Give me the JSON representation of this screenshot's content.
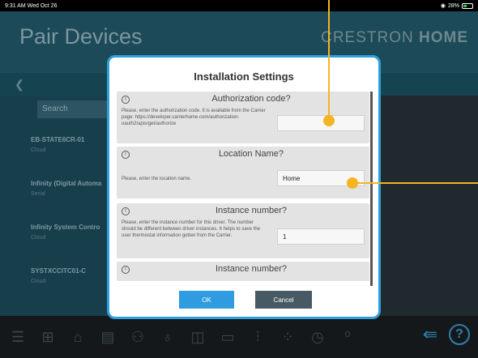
{
  "status_bar": {
    "time_date": "9:31 AM  Wed Oct 26",
    "battery": "28%"
  },
  "app": {
    "title": "Pair Devices",
    "brand_light": "CRESTRON",
    "brand_bold": "HOME"
  },
  "search": {
    "label": "Search"
  },
  "devices": [
    {
      "name": "EB-STATE6CR-01",
      "type": "Cloud"
    },
    {
      "name": "Infinity (Digital Automa",
      "type": "Serial"
    },
    {
      "name": "Infinity System Contro",
      "type": "Cloud"
    },
    {
      "name": "SYSTXCCITC01-C",
      "type": "Cloud"
    }
  ],
  "modal": {
    "title": "Installation Settings",
    "sections": [
      {
        "title": "Authorization code?",
        "desc": "Please, enter the authorization code. It is available from the Carrier page: https://developer.carrierhome.com/authorization-oauth2/apis/get/authorize",
        "value": ""
      },
      {
        "title": "Location Name?",
        "desc": "Please, enter the location name.",
        "value": "Home"
      },
      {
        "title": "Instance number?",
        "desc": "Please, enter the instance number for this driver. The number should be different between driver instances. It helps to save the user thermostat information gotten from the Carrier.",
        "value": "1"
      },
      {
        "title": "Instance number?"
      }
    ],
    "ok_label": "OK",
    "cancel_label": "Cancel"
  },
  "icons": {
    "menu": "menu-icon",
    "add_device": "add-device-icon",
    "wifi_device": "wifi-device-icon",
    "back_arrow": "back-arrow-icon",
    "help": "?"
  },
  "colors": {
    "accent": "#2f9be0",
    "annotation": "#f5b521",
    "header": "#1c4a58"
  }
}
